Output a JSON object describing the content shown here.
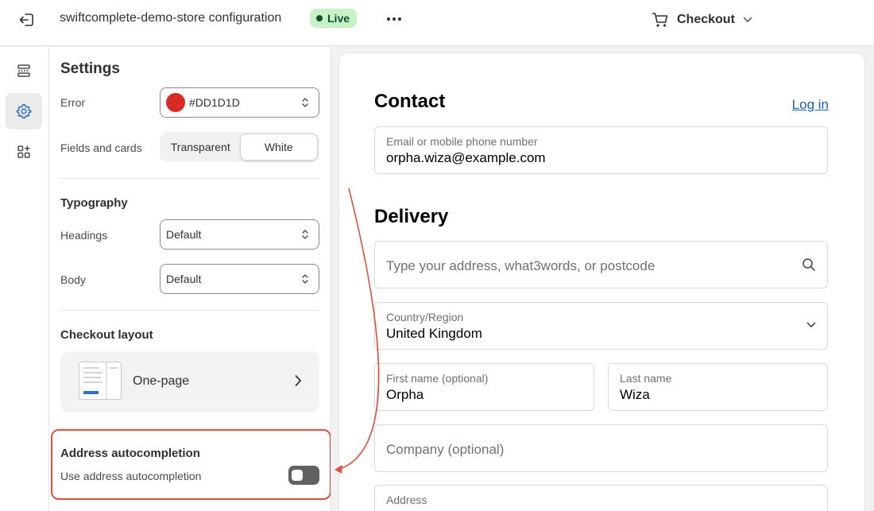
{
  "topbar": {
    "store_title": "swiftcomplete-demo-store configuration",
    "status_badge": "Live",
    "page_selector": "Checkout"
  },
  "rail": {
    "items": [
      {
        "icon": "sections-icon",
        "active": false
      },
      {
        "icon": "settings-gear-icon",
        "active": true
      },
      {
        "icon": "apps-icon",
        "active": false
      }
    ]
  },
  "settings": {
    "title": "Settings",
    "error": {
      "label": "Error",
      "value": "#DD1D1D",
      "swatch_color": "#d92b23"
    },
    "fields_and_cards": {
      "label": "Fields and cards",
      "options": [
        "Transparent",
        "White"
      ],
      "selected": "White"
    },
    "typography": {
      "title": "Typography",
      "headings": {
        "label": "Headings",
        "value": "Default"
      },
      "body": {
        "label": "Body",
        "value": "Default"
      }
    },
    "checkout_layout": {
      "title": "Checkout layout",
      "value": "One-page"
    },
    "address_autocompletion": {
      "title": "Address autocompletion",
      "toggle_label": "Use address autocompletion",
      "enabled": false
    }
  },
  "preview": {
    "contact": {
      "title": "Contact",
      "login_link": "Log in",
      "email_label": "Email or mobile phone number",
      "email_value": "orpha.wiza@example.com"
    },
    "delivery": {
      "title": "Delivery",
      "address_search_placeholder": "Type your address, what3words, or postcode",
      "country_label": "Country/Region",
      "country_value": "United Kingdom",
      "first_name_label": "First name (optional)",
      "first_name_value": "Orpha",
      "last_name_label": "Last name",
      "last_name_value": "Wiza",
      "company_placeholder": "Company (optional)",
      "address_label": "Address"
    }
  },
  "colors": {
    "accent_highlight": "#e0503a",
    "live_badge_bg": "#c7f2c6",
    "link": "#1a63b8"
  }
}
